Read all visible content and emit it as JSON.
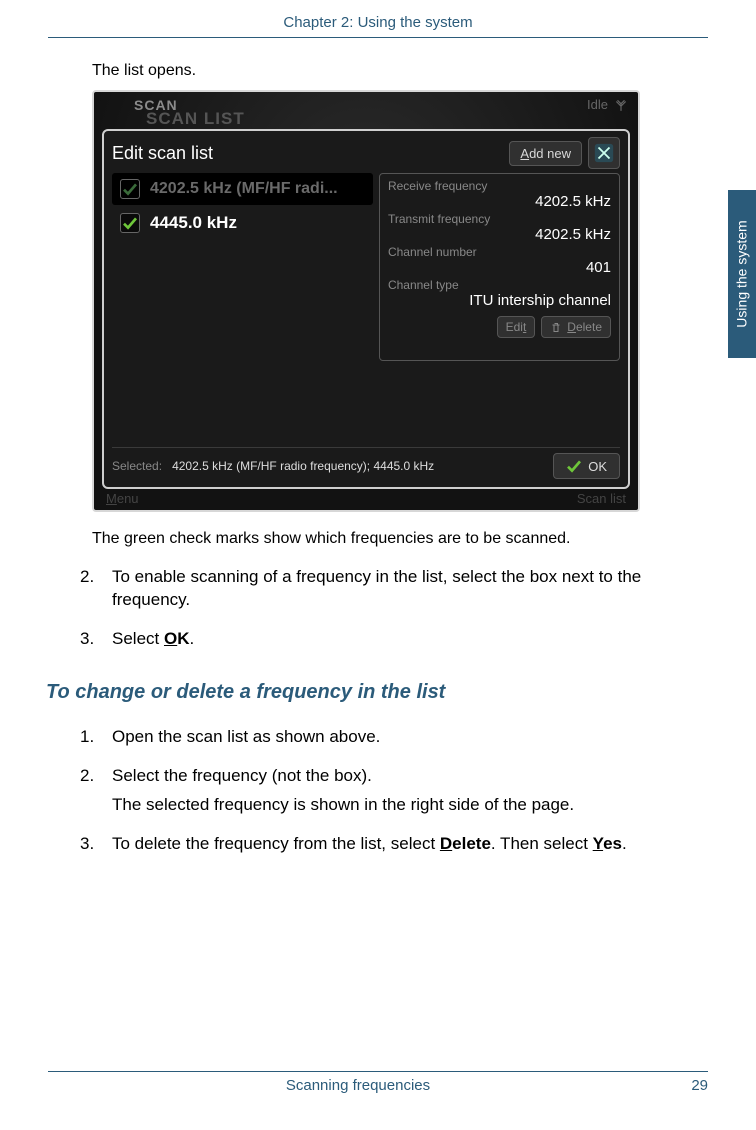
{
  "header": {
    "chapter": "Chapter 2:  Using the system"
  },
  "side_tab": "Using the system",
  "intro": "The list opens.",
  "device": {
    "top": {
      "scan1": "SCAN",
      "scan2": "SCAN LIST",
      "idle": "Idle"
    },
    "modal": {
      "title": "Edit scan list",
      "add_new": "Add new",
      "rows": [
        {
          "label": "4202.5 kHz (MF/HF radi...",
          "checked_dim": true
        },
        {
          "label": "4445.0 kHz",
          "checked_dim": false
        }
      ],
      "detail": {
        "rx_label": "Receive frequency",
        "rx_value": "4202.5 kHz",
        "tx_label": "Transmit frequency",
        "tx_value": "4202.5 kHz",
        "ch_label": "Channel number",
        "ch_value": "401",
        "ct_label": "Channel type",
        "ct_value": "ITU intership channel",
        "edit_btn": "Edit",
        "delete_btn": "Delete"
      },
      "footer": {
        "selected_label": "Selected:",
        "selected_value": "4202.5 kHz (MF/HF radio frequency); 4445.0 kHz",
        "ok": "OK"
      }
    },
    "bottom": {
      "menu": "Menu",
      "scanlist": "Scan list"
    }
  },
  "caption": "The green check marks show which frequencies are to be scanned.",
  "listA": {
    "2": "To enable scanning of a frequency in the list, select the box next to the frequency.",
    "3a": "Select ",
    "3b": "OK",
    "3c": "."
  },
  "h3": "To change or delete a frequency in the list",
  "listB": {
    "1": "Open the scan list as shown above.",
    "2": "Select the frequency (not the box).",
    "2sub": "The selected frequency is shown in the right side of the page.",
    "3a": "To delete the frequency from the list, select ",
    "3b": "Delete",
    "3c": ". Then select ",
    "3d": "Yes",
    "3e": "."
  },
  "footer": {
    "title": "Scanning frequencies",
    "page": "29"
  }
}
